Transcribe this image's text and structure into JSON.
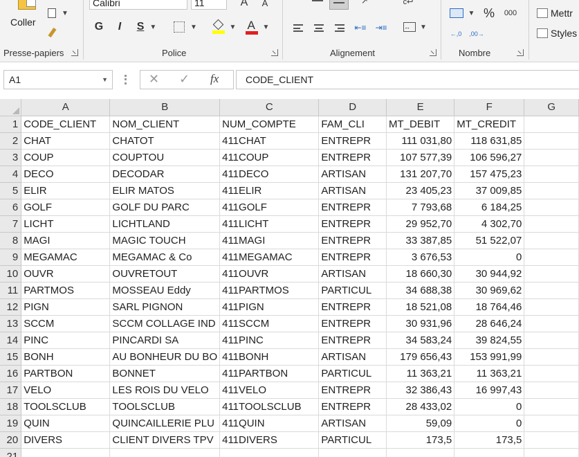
{
  "ribbon": {
    "clipboard": {
      "label": "Presse-papiers",
      "paste_label": "Coller"
    },
    "police": {
      "label": "Police",
      "font_name": "Calibri",
      "font_size": "11",
      "bold": "G",
      "italic": "I",
      "underline": "S"
    },
    "alignment": {
      "label": "Alignement"
    },
    "number": {
      "label": "Nombre",
      "percent": "%",
      "thousands": "000"
    },
    "styles": {
      "mettre": "Mettr",
      "styles": "Styles"
    }
  },
  "formula_bar": {
    "name_box": "A1",
    "fx": "fx",
    "content": "CODE_CLIENT"
  },
  "sheet": {
    "column_headers": [
      "A",
      "B",
      "C",
      "D",
      "E",
      "F",
      "G"
    ],
    "rows": [
      {
        "n": "1",
        "cells": [
          "CODE_CLIENT",
          "NOM_CLIENT",
          "NUM_COMPTE",
          "FAM_CLI",
          "MT_DEBIT",
          "MT_CREDIT"
        ]
      },
      {
        "n": "2",
        "cells": [
          "CHAT",
          "CHATOT",
          "411CHAT",
          "ENTREPR",
          "111 031,80",
          "118 631,85"
        ]
      },
      {
        "n": "3",
        "cells": [
          "COUP",
          "COUPTOU",
          "411COUP",
          "ENTREPR",
          "107 577,39",
          "106 596,27"
        ]
      },
      {
        "n": "4",
        "cells": [
          "DECO",
          "DECODAR",
          "411DECO",
          "ARTISAN",
          "131 207,70",
          "157 475,23"
        ]
      },
      {
        "n": "5",
        "cells": [
          "ELIR",
          "ELIR MATOS",
          "411ELIR",
          "ARTISAN",
          "23 405,23",
          "37 009,85"
        ]
      },
      {
        "n": "6",
        "cells": [
          "GOLF",
          "GOLF DU PARC",
          "411GOLF",
          "ENTREPR",
          "7 793,68",
          "6 184,25"
        ]
      },
      {
        "n": "7",
        "cells": [
          "LICHT",
          "LICHTLAND",
          "411LICHT",
          "ENTREPR",
          "29 952,70",
          "4 302,70"
        ]
      },
      {
        "n": "8",
        "cells": [
          "MAGI",
          "MAGIC TOUCH",
          "411MAGI",
          "ENTREPR",
          "33 387,85",
          "51 522,07"
        ]
      },
      {
        "n": "9",
        "cells": [
          "MEGAMAC",
          "MEGAMAC & Co",
          "411MEGAMAC",
          "ENTREPR",
          "3 676,53",
          "0"
        ]
      },
      {
        "n": "10",
        "cells": [
          "OUVR",
          "OUVRETOUT",
          "411OUVR",
          "ARTISAN",
          "18 660,30",
          "30 944,92"
        ]
      },
      {
        "n": "11",
        "cells": [
          "PARTMOS",
          "MOSSEAU Eddy",
          "411PARTMOS",
          "PARTICUL",
          "34 688,38",
          "30 969,62"
        ]
      },
      {
        "n": "12",
        "cells": [
          "PIGN",
          "SARL PIGNON",
          "411PIGN",
          "ENTREPR",
          "18 521,08",
          "18 764,46"
        ]
      },
      {
        "n": "13",
        "cells": [
          "SCCM",
          "SCCM COLLAGE IND",
          "411SCCM",
          "ENTREPR",
          "30 931,96",
          "28 646,24"
        ]
      },
      {
        "n": "14",
        "cells": [
          "PINC",
          "PINCARDI SA",
          "411PINC",
          "ENTREPR",
          "34 583,24",
          "39 824,55"
        ]
      },
      {
        "n": "15",
        "cells": [
          "BONH",
          "AU BONHEUR DU BO",
          "411BONH",
          "ARTISAN",
          "179 656,43",
          "153 991,99"
        ]
      },
      {
        "n": "16",
        "cells": [
          "PARTBON",
          "BONNET",
          "411PARTBON",
          "PARTICUL",
          "11 363,21",
          "11 363,21"
        ]
      },
      {
        "n": "17",
        "cells": [
          "VELO",
          "LES ROIS DU VELO",
          "411VELO",
          "ENTREPR",
          "32 386,43",
          "16 997,43"
        ]
      },
      {
        "n": "18",
        "cells": [
          "TOOLSCLUB",
          "TOOLSCLUB",
          "411TOOLSCLUB",
          "ENTREPR",
          "28 433,02",
          "0"
        ]
      },
      {
        "n": "19",
        "cells": [
          "QUIN",
          "QUINCAILLERIE PLU",
          "411QUIN",
          "ARTISAN",
          "59,09",
          "0"
        ]
      },
      {
        "n": "20",
        "cells": [
          "DIVERS",
          "CLIENT DIVERS TPV",
          "411DIVERS",
          "PARTICUL",
          "173,5",
          "173,5"
        ]
      },
      {
        "n": "21",
        "cells": [
          "",
          "",
          "",
          "",
          "",
          ""
        ]
      }
    ]
  },
  "colors": {
    "ribbon_bg": "#f3f3f3",
    "header_bg": "#e9e9e9",
    "gridline": "#dadada",
    "font_color_accent": "#e02020",
    "highlight_accent": "#ffff00"
  }
}
